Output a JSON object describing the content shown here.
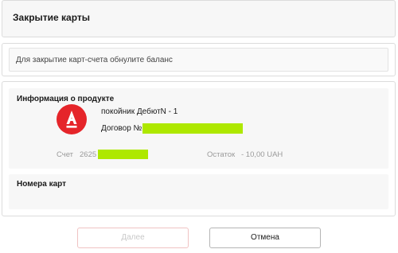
{
  "header": {
    "title": "Закрытие карты"
  },
  "info": {
    "message": "Для закрытие карт-счета обнулите баланс"
  },
  "product": {
    "section_title": "Информация о продукте",
    "name": "покойник ДебютN - 1",
    "contract_label": "Договор №",
    "account_label": "Счет",
    "account_value": "2625",
    "balance_label": "Остаток",
    "balance_value": "- 10,00 UAH",
    "logo_color": "#e5252a",
    "redaction_color": "#aee800"
  },
  "cards": {
    "section_title": "Номера карт"
  },
  "actions": {
    "next_label": "Далее",
    "cancel_label": "Отмена"
  }
}
